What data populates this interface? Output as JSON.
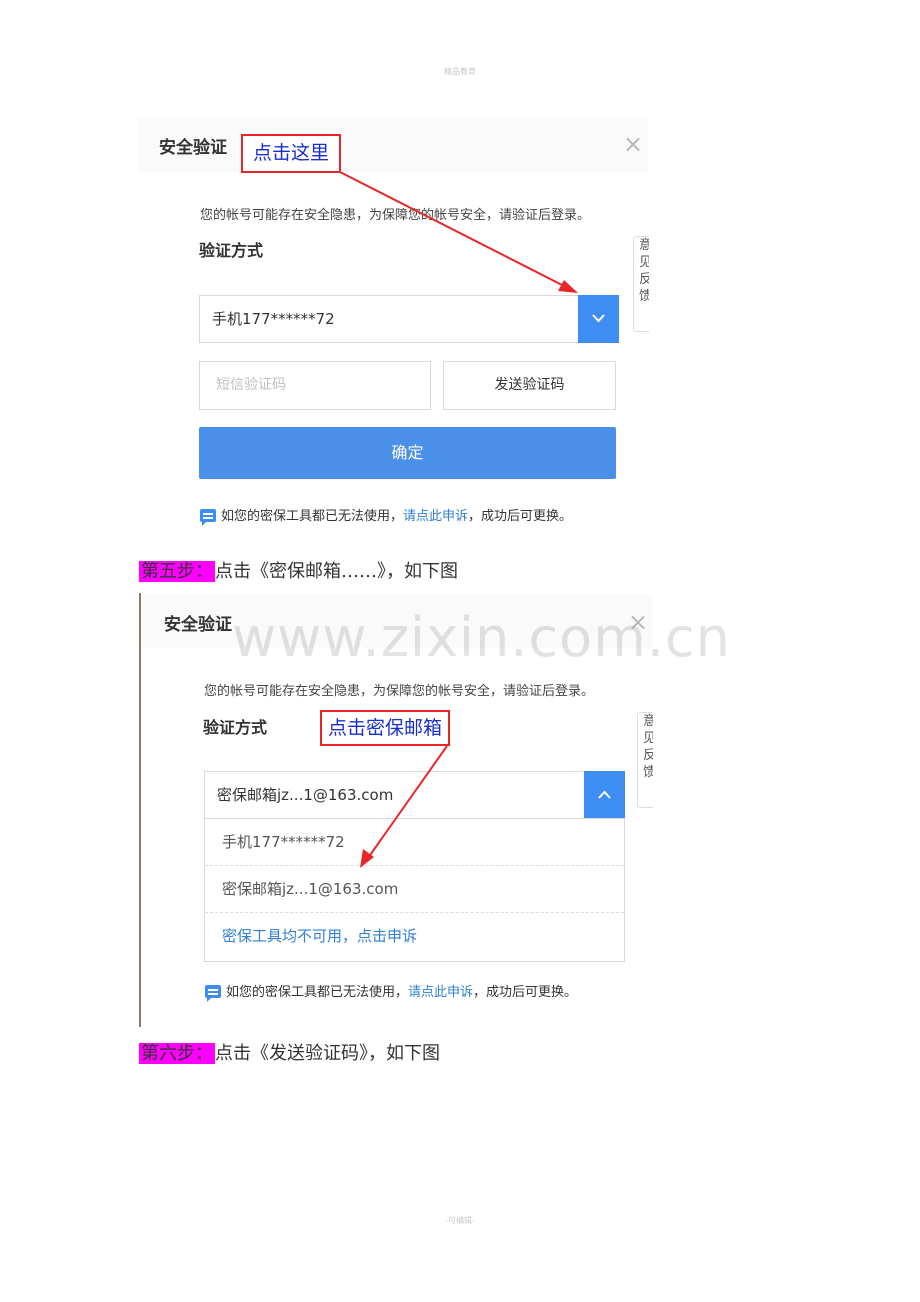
{
  "header_note": "精品教育",
  "footer_note": "-可编辑-",
  "panel1": {
    "title": "安全验证",
    "close_symbol": "×",
    "notice": "您的帐号可能存在安全隐患，为保障您的帐号安全，请验证后登录。",
    "method_label": "验证方式",
    "selected_method": "手机177******72",
    "sms_placeholder": "短信验证码",
    "send_button": "发送验证码",
    "confirm_button": "确定",
    "help_prefix": "如您的密保工具都已无法使用，",
    "help_link": "请点此申诉",
    "help_suffix": "，成功后可更换。",
    "side_tab": "意见反馈"
  },
  "annotation1": "点击这里",
  "step5": {
    "label": "第五步：",
    "text": "点击《密保邮箱……》，如下图"
  },
  "panel2": {
    "title": "安全验证",
    "close_symbol": "×",
    "notice": "您的帐号可能存在安全隐患，为保障您的帐号安全，请验证后登录。",
    "method_label": "验证方式",
    "selected_method": "密保邮箱jz...1@163.com",
    "options": [
      "手机177******72",
      "密保邮箱jz...1@163.com",
      "密保工具均不可用，点击申诉"
    ],
    "help_prefix": "如您的密保工具都已无法使用，",
    "help_link": "请点此申诉",
    "help_suffix": "，成功后可更换。",
    "side_tab": "意见反馈"
  },
  "annotation2": "点击密保邮箱",
  "watermark": "www.zixin.com.cn",
  "step6": {
    "label": "第六步：",
    "text": "点击《发送验证码》，如下图"
  },
  "colors": {
    "accent": "#3d8df2",
    "annotation_red": "#e8262a",
    "annotation_text": "#1a2fd0",
    "step_highlight": "#ff00ff",
    "link": "#2f7fd3"
  },
  "icons": [
    "close-icon",
    "chevron-down-icon",
    "chevron-up-icon",
    "chat-icon",
    "arrow-annotation"
  ]
}
